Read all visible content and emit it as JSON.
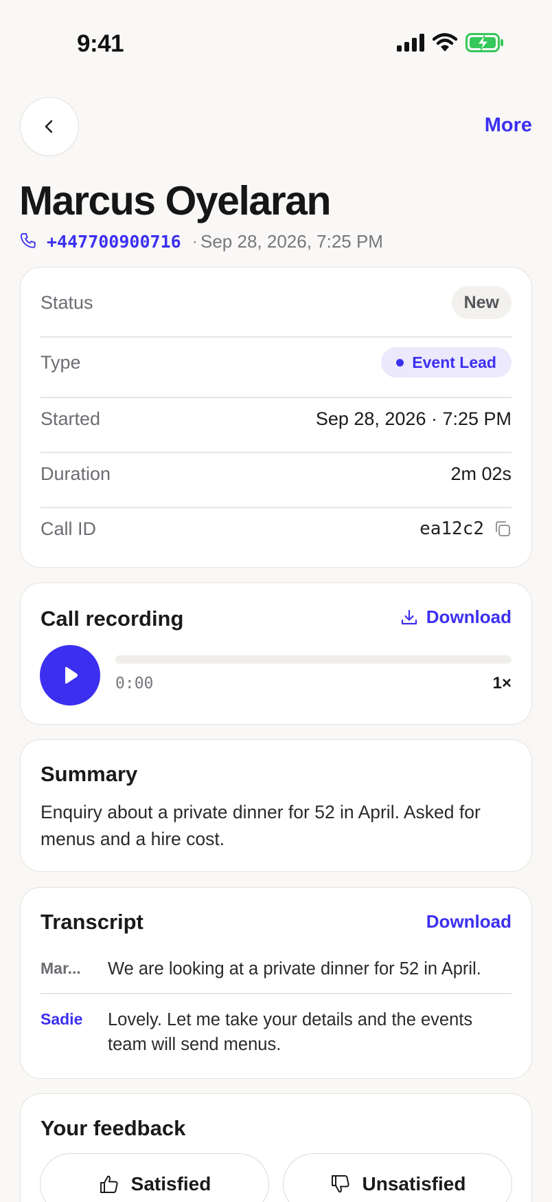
{
  "status_bar": {
    "time": "9:41"
  },
  "nav": {
    "more_label": "More"
  },
  "contact": {
    "name": "Marcus Oyelaran",
    "phone": "+447700900716",
    "separator": "·",
    "datetime": "Sep 28, 2026, 7:25 PM"
  },
  "details": {
    "status_label": "Status",
    "status_value": "New",
    "type_label": "Type",
    "type_value": "Event Lead",
    "started_label": "Started",
    "started_value": "Sep 28, 2026 · 7:25 PM",
    "duration_label": "Duration",
    "duration_value": "2m 02s",
    "callid_label": "Call ID",
    "callid_value": "ea12c2"
  },
  "recording": {
    "title": "Call recording",
    "download_label": "Download",
    "current_time": "0:00",
    "progress_fraction": 0,
    "speed": "1×"
  },
  "summary": {
    "title": "Summary",
    "text": "Enquiry about a private dinner for 52 in April. Asked for menus and a hire cost."
  },
  "transcript": {
    "title": "Transcript",
    "download_label": "Download",
    "lines": [
      {
        "speaker": "Mar...",
        "text": "We are looking at a private dinner for 52 in April."
      },
      {
        "speaker": "Sadie",
        "text": "Lovely. Let me take your details and the events team will send menus."
      }
    ]
  },
  "feedback": {
    "title": "Your feedback",
    "satisfied_label": "Satisfied",
    "unsatisfied_label": "Unsatisfied"
  },
  "colors": {
    "accent": "#3c2ff0",
    "background": "#f9f8f6",
    "battery": "#34c759"
  }
}
